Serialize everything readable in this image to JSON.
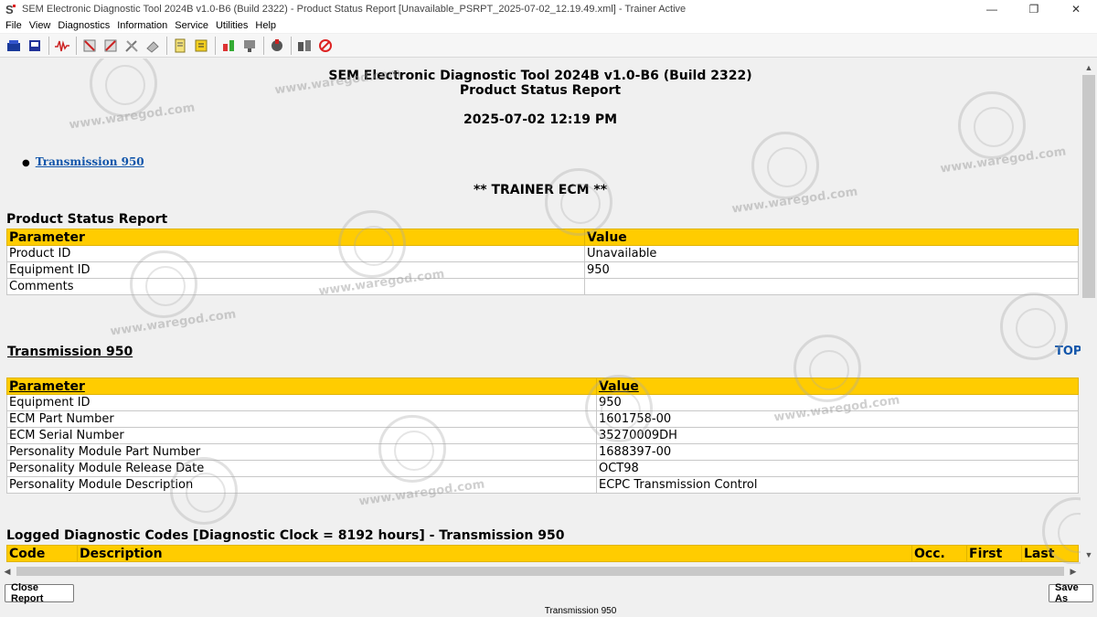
{
  "window": {
    "title": "SEM Electronic Diagnostic Tool 2024B v1.0-B6 (Build 2322) - Product Status Report [Unavailable_PSRPT_2025-07-02_12.19.49.xml] - Trainer Active",
    "app_icon_label": "S"
  },
  "menu": {
    "items": [
      "File",
      "View",
      "Diagnostics",
      "Information",
      "Service",
      "Utilities",
      "Help"
    ]
  },
  "toolbar": {
    "icons": [
      "connect-icon",
      "print-icon",
      "waveform-icon",
      "codes-icon",
      "clear-codes-icon",
      "tools-icon",
      "eraser-icon",
      "notepad-icon",
      "status-icon",
      "calibration-icon",
      "programming-icon",
      "engine-icon",
      "trainer-icon",
      "disconnect-icon"
    ]
  },
  "report": {
    "header_line1": "SEM Electronic Diagnostic Tool 2024B v1.0-B6 (Build 2322)",
    "header_line2": "Product Status Report",
    "timestamp": "2025-07-02 12:19 PM",
    "toc_link": "Transmission 950",
    "banner": "** TRAINER ECM **",
    "product_section_title": "Product Status Report",
    "product_table": {
      "headers": [
        "Parameter",
        "Value"
      ],
      "rows": [
        [
          "Product ID",
          "Unavailable"
        ],
        [
          "Equipment ID",
          "950"
        ],
        [
          "Comments",
          ""
        ]
      ]
    },
    "module_section_title": "Transmission 950",
    "top_link": "TOP",
    "module_table": {
      "headers": [
        "Parameter",
        "Value"
      ],
      "rows": [
        [
          "Equipment ID",
          "950"
        ],
        [
          "ECM Part Number",
          "1601758-00"
        ],
        [
          "ECM Serial Number",
          "35270009DH"
        ],
        [
          "Personality Module Part Number",
          "1688397-00"
        ],
        [
          "Personality Module Release Date",
          "OCT98"
        ],
        [
          "Personality Module Description",
          "ECPC Transmission Control"
        ]
      ]
    },
    "codes_section_title": "Logged Diagnostic Codes [Diagnostic Clock = 8192 hours] - Transmission 950",
    "codes_table": {
      "headers": [
        "Code",
        "Description",
        "Occ.",
        "First",
        "Last"
      ]
    }
  },
  "bottom": {
    "close_button": "Close Report",
    "save_button": "Save As",
    "status_tab": "Transmission 950"
  },
  "watermark": {
    "text": "www.waregod.com"
  }
}
